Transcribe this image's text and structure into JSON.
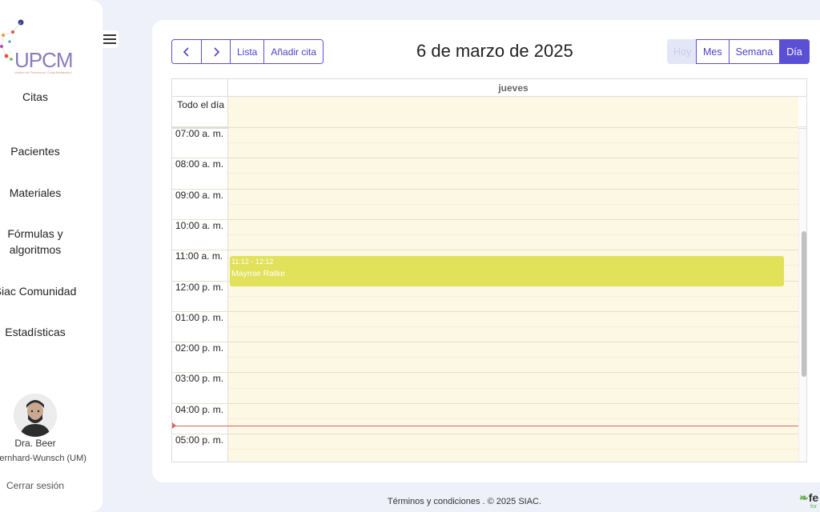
{
  "sidebar": {
    "logo_text": "UPCM",
    "logo_subtitle": "Unidad de Prevención Cuida Metabólico",
    "menu_icon": "hamburger-icon",
    "items": [
      {
        "label": "Citas"
      },
      {
        "label": "Pacientes"
      },
      {
        "label": "Materiales"
      },
      {
        "label": "Fórmulas y algoritmos"
      },
      {
        "label": "Siac Comunidad"
      },
      {
        "label": "Estadísticas"
      }
    ],
    "user": {
      "name": "Dra. Beer",
      "org": "Bernhard-Wunsch (UM)",
      "avatar_icon": "user-avatar"
    },
    "logout_label": "Cerrar sesión"
  },
  "toolbar": {
    "prev_icon": "chevron-left-icon",
    "next_icon": "chevron-right-icon",
    "list_label": "Lista",
    "add_label": "Añadir cita",
    "title": "6 de marzo de 2025",
    "views": {
      "today": "Hoy",
      "month": "Mes",
      "week": "Semana",
      "day": "Día"
    },
    "active_view": "Día"
  },
  "calendar": {
    "day_header": "jueves",
    "allday_label": "Todo el día",
    "time_slots": [
      "07:00 a. m.",
      "08:00 a. m.",
      "09:00 a. m.",
      "10:00 a. m.",
      "11:00 a. m.",
      "12:00 p. m.",
      "01:00 p. m.",
      "02:00 p. m.",
      "03:00 p. m.",
      "04:00 p. m.",
      "05:00 p. m."
    ],
    "events": [
      {
        "time": "11:12 - 12:12",
        "title": "Maymie Ratke",
        "color": "#e1e15a"
      }
    ],
    "now_time": "16:45",
    "colors": {
      "accent": "#5b4fd6",
      "day_bg": "#fcf8e3",
      "now_line": "#e0645a"
    }
  },
  "footer": {
    "text": "Términos y condiciones . © 2025 SIAC."
  },
  "corner_logo": {
    "text": "fe",
    "small": "for"
  }
}
